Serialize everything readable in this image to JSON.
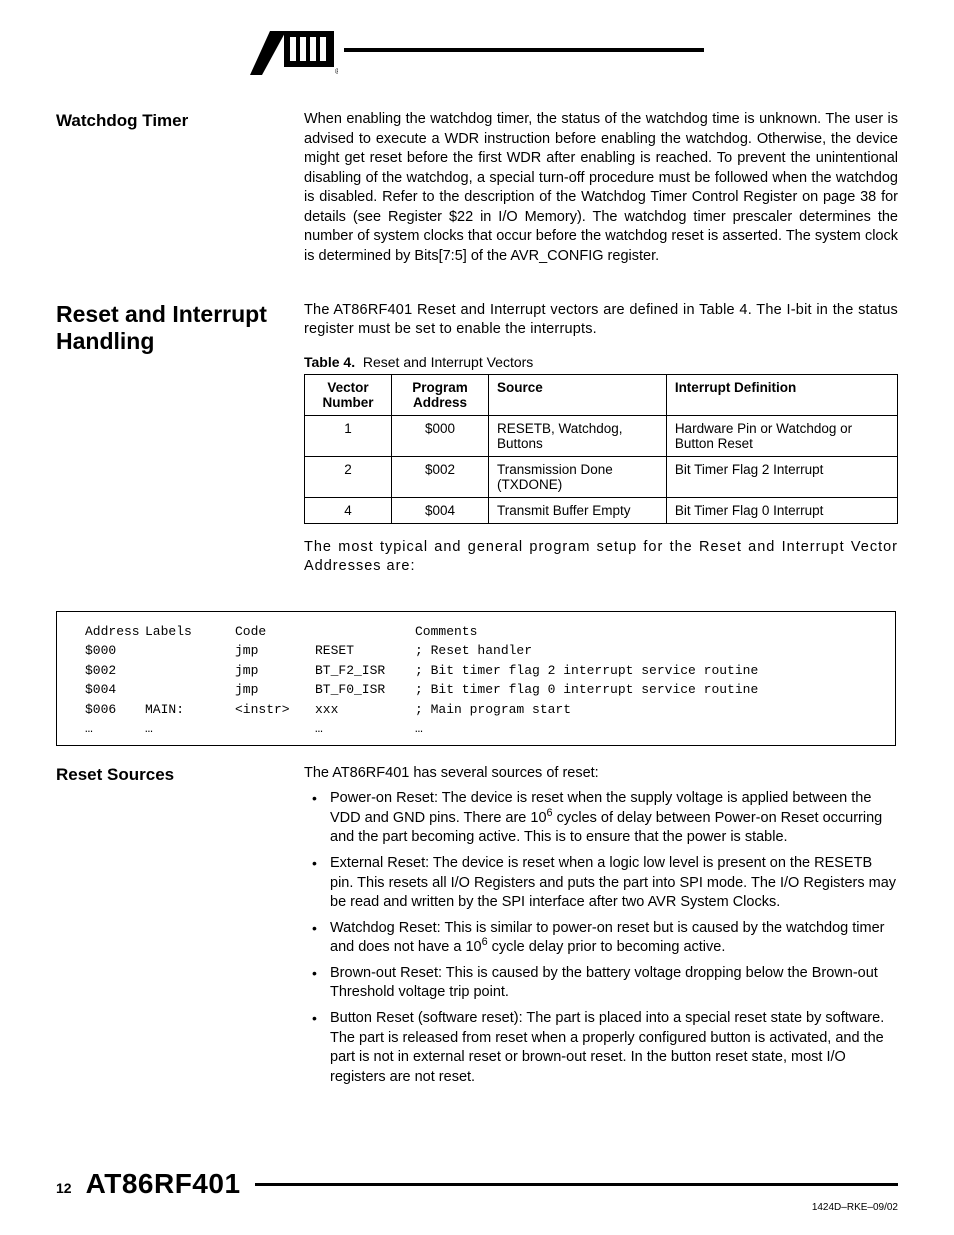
{
  "header": {
    "logo_text": "ATMEL"
  },
  "sections": {
    "watchdog": {
      "heading": "Watchdog Timer",
      "para": "When enabling the watchdog timer, the status of the watchdog time is unknown. The user is advised to execute a WDR instruction before enabling the watchdog. Otherwise, the device might get reset before the first WDR after enabling is reached. To prevent the unintentional disabling of the watchdog, a special turn-off procedure must be followed when the watchdog is disabled. Refer to the description of the Watchdog Timer Control Register on page 38 for details (see Register $22 in I/O Memory). The watchdog timer prescaler determines the number of system clocks that occur before the watchdog reset is asserted. The system clock is determined by Bits[7:5] of the AVR_CONFIG register."
    },
    "reset_interrupt": {
      "heading": "Reset and Interrupt Handling",
      "intro": "The AT86RF401 Reset and Interrupt vectors are defined in Table 4. The I-bit in the status register must be set to enable the interrupts.",
      "table_caption_bold": "Table 4.",
      "table_caption_rest": "Reset and Interrupt Vectors",
      "table": {
        "headers": [
          "Vector Number",
          "Program Address",
          "Source",
          "Interrupt Definition"
        ],
        "rows": [
          [
            "1",
            "$000",
            "RESETB, Watchdog, Buttons",
            "Hardware Pin or Watchdog or Button Reset"
          ],
          [
            "2",
            "$002",
            "Transmission Done (TXDONE)",
            "Bit Timer Flag 2 Interrupt"
          ],
          [
            "4",
            "$004",
            "Transmit Buffer Empty",
            "Bit Timer Flag 0 Interrupt"
          ]
        ]
      },
      "after_table": "The most typical and general program setup for the Reset and Interrupt Vector Addresses are:"
    },
    "code": {
      "head": [
        "Address",
        "Labels",
        "Code",
        "",
        "Comments"
      ],
      "rows": [
        [
          "$000",
          "",
          "jmp",
          "RESET",
          "; Reset handler"
        ],
        [
          "$002",
          "",
          "jmp",
          "BT_F2_ISR",
          "; Bit timer flag 2 interrupt service routine"
        ],
        [
          "$004",
          "",
          "jmp",
          "BT_F0_ISR",
          "; Bit timer flag 0 interrupt service routine"
        ],
        [
          "$006",
          "MAIN:",
          "<instr>",
          "xxx",
          "; Main program start"
        ],
        [
          "…",
          "…",
          "",
          "…",
          "…"
        ]
      ]
    },
    "reset_sources": {
      "heading": "Reset Sources",
      "intro": "The AT86RF401 has several sources of reset:",
      "bullets": [
        {
          "pre": "Power-on Reset: The device is reset when the supply voltage is applied between the VDD and GND pins. There are 10",
          "sup": "6",
          "post": " cycles of delay between Power-on Reset occurring and the part becoming active. This is to ensure that the power is stable."
        },
        {
          "pre": "External Reset: The device is reset when a logic low level is present on the RESETB pin. This resets all I/O Registers and puts the part into SPI mode. The I/O Registers may be read and written by the SPI interface after two AVR System Clocks.",
          "sup": "",
          "post": ""
        },
        {
          "pre": "Watchdog Reset: This is similar to power-on reset but is caused by the watchdog timer and does not have a 10",
          "sup": "6",
          "post": " cycle delay prior to becoming active."
        },
        {
          "pre": "Brown-out Reset: This is caused by the battery voltage dropping below the Brown-out Threshold voltage trip point.",
          "sup": "",
          "post": ""
        },
        {
          "pre": "Button Reset (software reset): The part is placed into a special reset state by software. The part is released from reset when a properly configured button is activated, and the part is not in external reset or brown-out reset. In the button reset state, most I/O registers are not reset.",
          "sup": "",
          "post": ""
        }
      ]
    }
  },
  "footer": {
    "page_number": "12",
    "doc_title": "AT86RF401",
    "doc_id": "1424D–RKE–09/02"
  }
}
